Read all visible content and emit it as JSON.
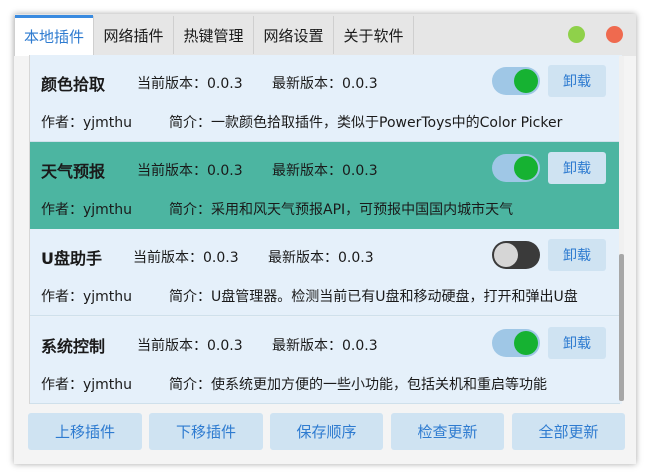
{
  "tabs": [
    {
      "label": "本地插件",
      "active": true
    },
    {
      "label": "网络插件",
      "active": false
    },
    {
      "label": "热键管理",
      "active": false
    },
    {
      "label": "网络设置",
      "active": false
    },
    {
      "label": "关于软件",
      "active": false
    }
  ],
  "window_controls": {
    "maximize_color": "#8fd14a",
    "close_color": "#ef6a4f"
  },
  "plugins": [
    {
      "name": "颜色拾取",
      "current_version": "当前版本：0.0.3",
      "latest_version": "最新版本：0.0.3",
      "author": "作者：yjmthu",
      "description": "简介：一款颜色拾取插件，类似于PowerToys中的Color Picker",
      "enabled": true,
      "uninstall_label": "卸载"
    },
    {
      "name": "天气预报",
      "current_version": "当前版本：0.0.3",
      "latest_version": "最新版本：0.0.3",
      "author": "作者：yjmthu",
      "description": "简介：采用和风天气预报API，可预报中国国内城市天气",
      "enabled": true,
      "uninstall_label": "卸载",
      "selected": true
    },
    {
      "name": "U盘助手",
      "current_version": "当前版本：0.0.3",
      "latest_version": "最新版本：0.0.3",
      "author": "作者：yjmthu",
      "description": "简介：U盘管理器。检测当前已有U盘和移动硬盘，打开和弹出U盘",
      "enabled": false,
      "uninstall_label": "卸载"
    },
    {
      "name": "系统控制",
      "current_version": "当前版本：0.0.3",
      "latest_version": "最新版本：0.0.3",
      "author": "作者：yjmthu",
      "description": "简介：使系统更加方便的一些小功能，包括关机和重启等功能",
      "enabled": true,
      "uninstall_label": "卸载"
    }
  ],
  "buttons": {
    "move_up": "上移插件",
    "move_down": "下移插件",
    "save_order": "保存顺序",
    "check_update": "检查更新",
    "update_all": "全部更新"
  },
  "colors": {
    "accent": "#2e7bd0",
    "selected_row": "#4cb5a1",
    "toggle_on": "#16b232"
  }
}
